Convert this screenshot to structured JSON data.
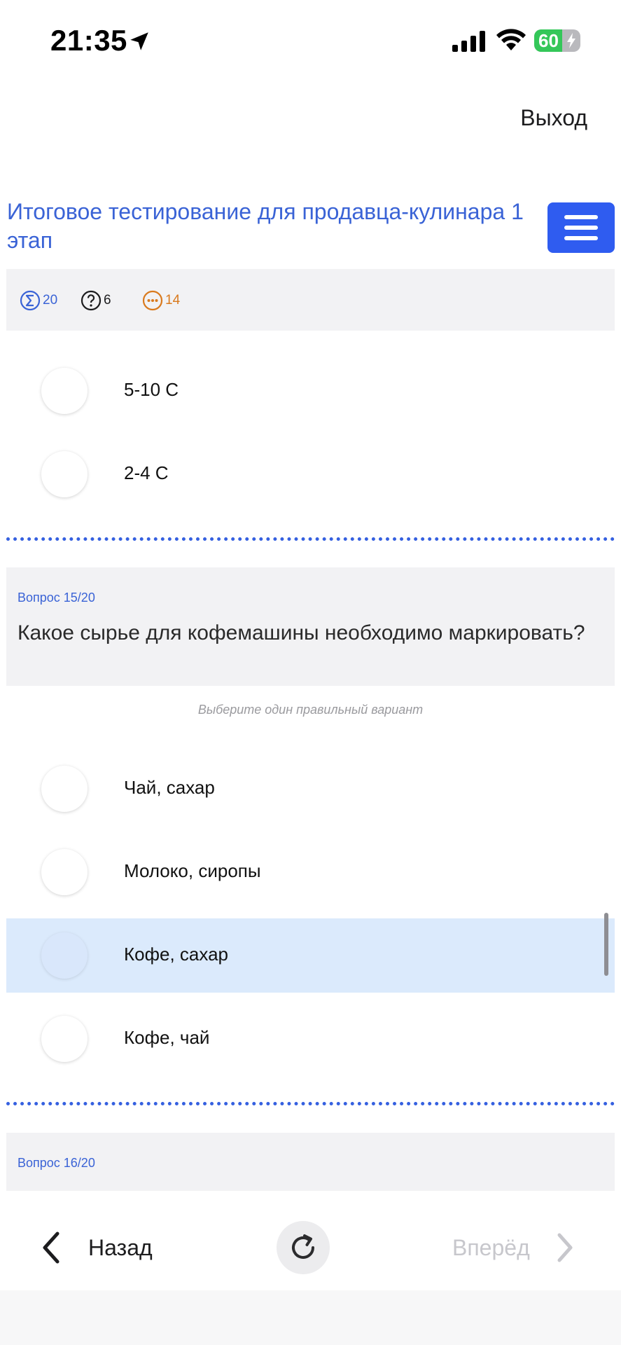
{
  "status_bar": {
    "time": "21:35",
    "battery": "60",
    "battery_level": 0.6,
    "location_icon": "location-arrow-icon",
    "signal_icon": "cellular-signal-icon",
    "wifi_icon": "wifi-icon"
  },
  "header": {
    "exit_label": "Выход",
    "title": "Итоговое тестирование для продавца-кулинара 1 этап",
    "menu_icon": "hamburger-menu-icon"
  },
  "stats": {
    "total": "20",
    "remaining": "6",
    "in_progress": "14",
    "colors": {
      "total": "#3a63d6",
      "remaining": "#1c1c1e",
      "in_progress": "#d97a1e"
    }
  },
  "previous_question": {
    "options": [
      "5-10 С",
      "2-4 С"
    ]
  },
  "question_15": {
    "number": "Вопрос 15/20",
    "text": "Какое сырье для кофемашины необходимо маркировать?",
    "hint": "Выберите один правильный вариант",
    "options": [
      "Чай, сахар",
      "Молоко, сиропы",
      "Кофе, сахар",
      "Кофе, чай"
    ],
    "selected_option": "Кофе, сахар"
  },
  "question_16": {
    "number": "Вопрос 16/20"
  },
  "bottom_nav": {
    "back_label": "Назад",
    "forward_label": "Вперёд"
  },
  "colors": {
    "accent": "#2f5cf0",
    "title": "#3a63d6",
    "selected_bg": "#dbeafc",
    "card_bg": "#f2f2f4"
  }
}
